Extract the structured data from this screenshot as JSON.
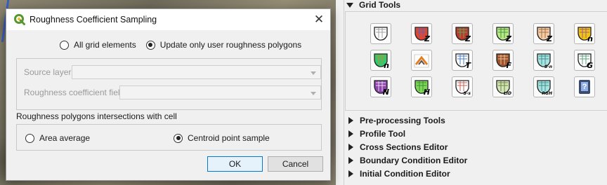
{
  "dialog": {
    "title": "Roughness Coefficient Sampling",
    "close_glyph": "✕",
    "mode_options": [
      {
        "label": "All grid elements",
        "selected": false
      },
      {
        "label": "Update only user roughness polygons",
        "selected": true
      }
    ],
    "source_layer_label": "Source layer",
    "source_layer_value": "",
    "roughness_field_label": "Roughness coefficient field",
    "roughness_field_value": "",
    "intersection_label": "Roughness polygons intersections with cell",
    "intersection_options": [
      {
        "label": "Area average",
        "selected": false
      },
      {
        "label": "Centroid point sample",
        "selected": true
      }
    ],
    "ok_label": "OK",
    "cancel_label": "Cancel"
  },
  "panel": {
    "grid_tools_label": "Grid Tools",
    "tools": [
      {
        "icon": "create-grid-icon",
        "letter": ""
      },
      {
        "icon": "elevation-z-icon",
        "letter": "Z"
      },
      {
        "icon": "points-z-icon",
        "letter": "Z"
      },
      {
        "icon": "green-points-z-icon",
        "letter": "Z"
      },
      {
        "icon": "polygon-z-icon",
        "letter": "Z"
      },
      {
        "icon": "roughness-n-icon",
        "letter": "n"
      },
      {
        "icon": "roughness-n-color-icon",
        "letter": "n"
      },
      {
        "icon": "arrows-icon",
        "letter": ""
      },
      {
        "icon": "tailwater-t-icon",
        "letter": "T"
      },
      {
        "icon": "arf-f-icon",
        "letter": "F"
      },
      {
        "icon": "sample-s-n-icon",
        "letter": "S-n"
      },
      {
        "icon": "grid-g-icon",
        "letter": "G"
      },
      {
        "icon": "manning-n-icon",
        "letter": "N"
      },
      {
        "icon": "depth-h-icon",
        "letter": "H"
      },
      {
        "icon": "sample-s-s-icon",
        "letter": "S-s"
      },
      {
        "icon": "lid-icon",
        "letter": "LID"
      },
      {
        "icon": "rgh-icon",
        "letter": "RGH"
      },
      {
        "icon": "help-icon",
        "letter": "?"
      }
    ],
    "tree_items": [
      "Pre-processing Tools",
      "Profile Tool",
      "Cross Sections Editor",
      "Boundary Condition Editor",
      "Initial Condition Editor"
    ]
  },
  "colors": {
    "accent": "#0078d7",
    "qgis_green": "#589632"
  }
}
